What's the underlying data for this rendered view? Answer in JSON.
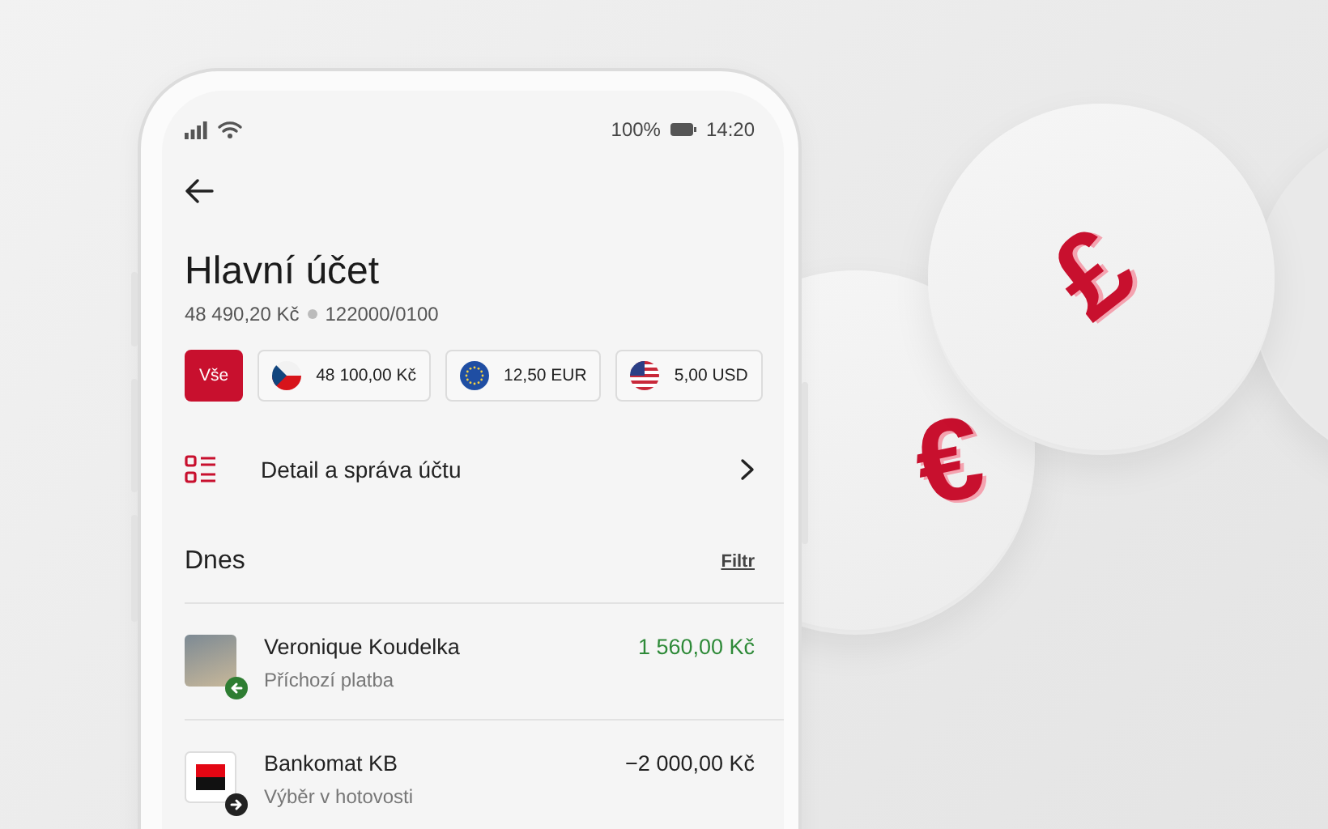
{
  "coins": [
    {
      "symbol": "€"
    },
    {
      "symbol": "£"
    }
  ],
  "status_bar": {
    "battery": "100%",
    "time": "14:20"
  },
  "header": {
    "title": "Hlavní účet",
    "balance": "48 490,20 Kč",
    "account_number": "122000/0100"
  },
  "currency_chips": [
    {
      "label": "Vše",
      "kind": "all",
      "selected": true
    },
    {
      "label": "48 100,00 Kč",
      "kind": "czk",
      "selected": false
    },
    {
      "label": "12,50 EUR",
      "kind": "eur",
      "selected": false
    },
    {
      "label": "5,00 USD",
      "kind": "usd",
      "selected": false
    }
  ],
  "menu_item": {
    "label": "Detail a správa účtu"
  },
  "section": {
    "title": "Dnes",
    "filter_link": "Filtr"
  },
  "transactions": [
    {
      "name": "Veronique Koudelka",
      "description": "Příchozí platba",
      "amount": "1 560,00 Kč",
      "incoming": true,
      "kind": "person"
    },
    {
      "name": "Bankomat KB",
      "description": "Výběr v hotovosti",
      "amount": "−2 000,00 Kč",
      "incoming": false,
      "kind": "merchant"
    }
  ]
}
